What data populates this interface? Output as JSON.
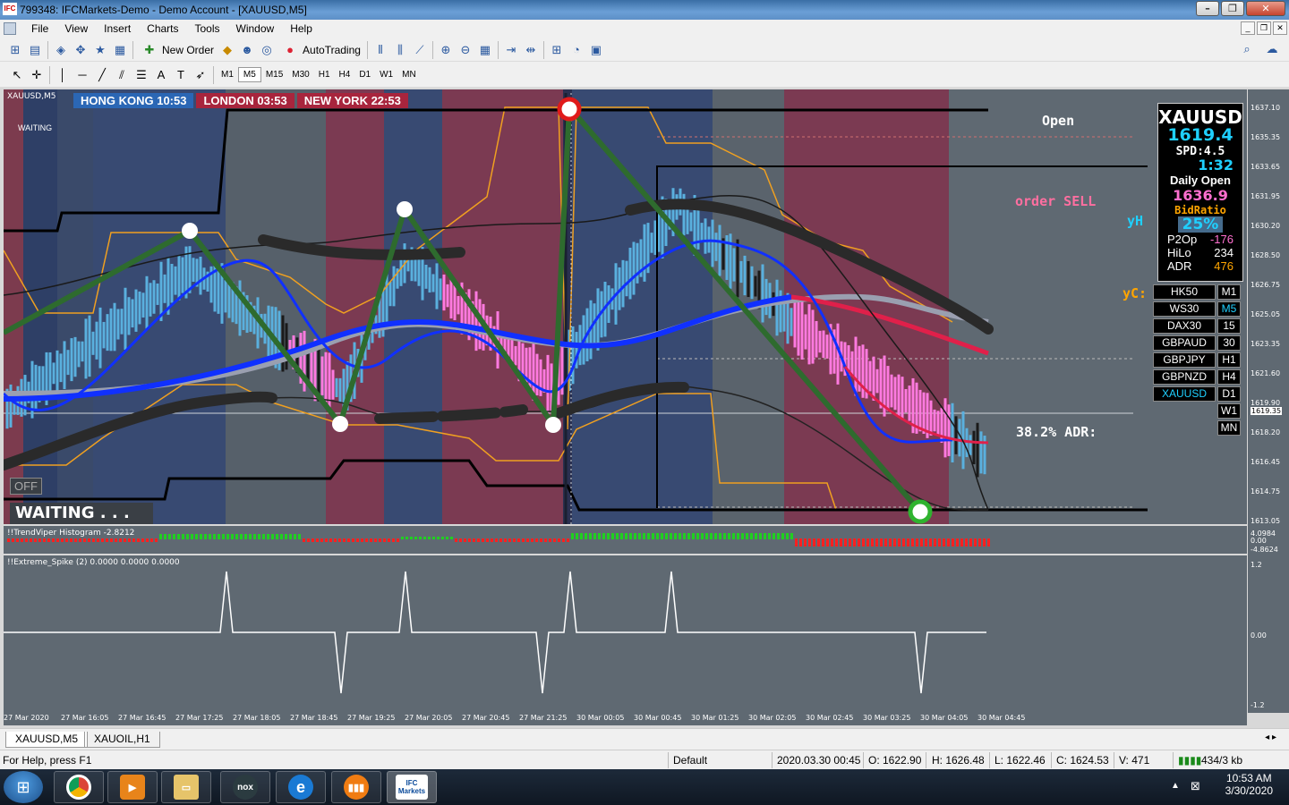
{
  "window": {
    "title": "799348: IFCMarkets-Demo - Demo Account - [XAUUSD,M5]",
    "app_icon_text": "IFC"
  },
  "menu": [
    "File",
    "View",
    "Insert",
    "Charts",
    "Tools",
    "Window",
    "Help"
  ],
  "toolbar": {
    "new_order_label": "New Order",
    "autotrading_label": "AutoTrading"
  },
  "timeframes": [
    "M1",
    "M5",
    "M15",
    "M30",
    "H1",
    "H4",
    "D1",
    "W1",
    "MN"
  ],
  "active_timeframe": "M5",
  "chart": {
    "symbol_label": "XAUUSD,M5",
    "waiting_small": "WAITING",
    "sessions": [
      {
        "label": "HONG KONG 10:53",
        "color": "#2b67b5"
      },
      {
        "label": "LONDON 03:53",
        "color": "#a8253d"
      },
      {
        "label": "NEW YORK 22:53",
        "color": "#a8253d"
      }
    ],
    "open_label": "Open",
    "order_label": "order SELL",
    "yh_label": "yH",
    "yc_label": "yC:",
    "adr_label": "38.2% ADR:",
    "off_label": "OFF",
    "waiting_big": "WAITING . . .",
    "current_price": "1619.35"
  },
  "info_panel": {
    "symbol": "XAUUSD",
    "price": "1619.4",
    "spread": "SPD:4.5",
    "timer": "1:32",
    "daily_open_label": "Daily Open",
    "daily_open_value": "1636.9",
    "bid_ratio_label": "BidRatio",
    "bid_ratio_value": "25%",
    "p2op_label": "P2Op",
    "p2op_value": "-176",
    "hilo_label": "HiLo",
    "hilo_value": "234",
    "adr_label": "ADR",
    "adr_value": "476"
  },
  "symbol_buttons": [
    "HK50",
    "WS30",
    "DAX30",
    "GBPAUD",
    "GBPJPY",
    "GBPNZD",
    "XAUUSD"
  ],
  "tf_buttons": [
    "M1",
    "M5",
    "15",
    "30",
    "H1",
    "H4",
    "D1",
    "W1",
    "MN"
  ],
  "price_scale": [
    "1637.10",
    "1635.35",
    "1633.65",
    "1631.95",
    "1630.20",
    "1628.50",
    "1626.75",
    "1625.05",
    "1623.35",
    "1621.60",
    "1619.90",
    "1618.20",
    "1616.45",
    "1614.75",
    "1613.05"
  ],
  "histogram": {
    "label": "!!TrendViper Histogram -2.8212",
    "scale": [
      "4.0984",
      "0.00",
      "-4.8624"
    ]
  },
  "spike": {
    "label": "!!Extreme_Spike (2) 0.0000 0.0000 0.0000",
    "scale": [
      "1.2",
      "0.00",
      "-1.2"
    ]
  },
  "time_axis": [
    "27 Mar 2020",
    "27 Mar 16:05",
    "27 Mar 16:45",
    "27 Mar 17:25",
    "27 Mar 18:05",
    "27 Mar 18:45",
    "27 Mar 19:25",
    "27 Mar 20:05",
    "27 Mar 20:45",
    "27 Mar 21:25",
    "30 Mar 00:05",
    "30 Mar 00:45",
    "30 Mar 01:25",
    "30 Mar 02:05",
    "30 Mar 02:45",
    "30 Mar 03:25",
    "30 Mar 04:05",
    "30 Mar 04:45"
  ],
  "tabs": [
    "XAUUSD,M5",
    "XAUOIL,H1"
  ],
  "status": {
    "help": "For Help, press F1",
    "profile": "Default",
    "datetime": "2020.03.30 00:45",
    "open": "O: 1622.90",
    "high": "H: 1626.48",
    "low": "L: 1622.46",
    "close": "C: 1624.53",
    "volume": "V: 471",
    "traffic": "434/3 kb"
  },
  "taskbar": {
    "time": "10:53 AM",
    "date": "3/30/2020",
    "ifc_label": "IFC Markets"
  }
}
